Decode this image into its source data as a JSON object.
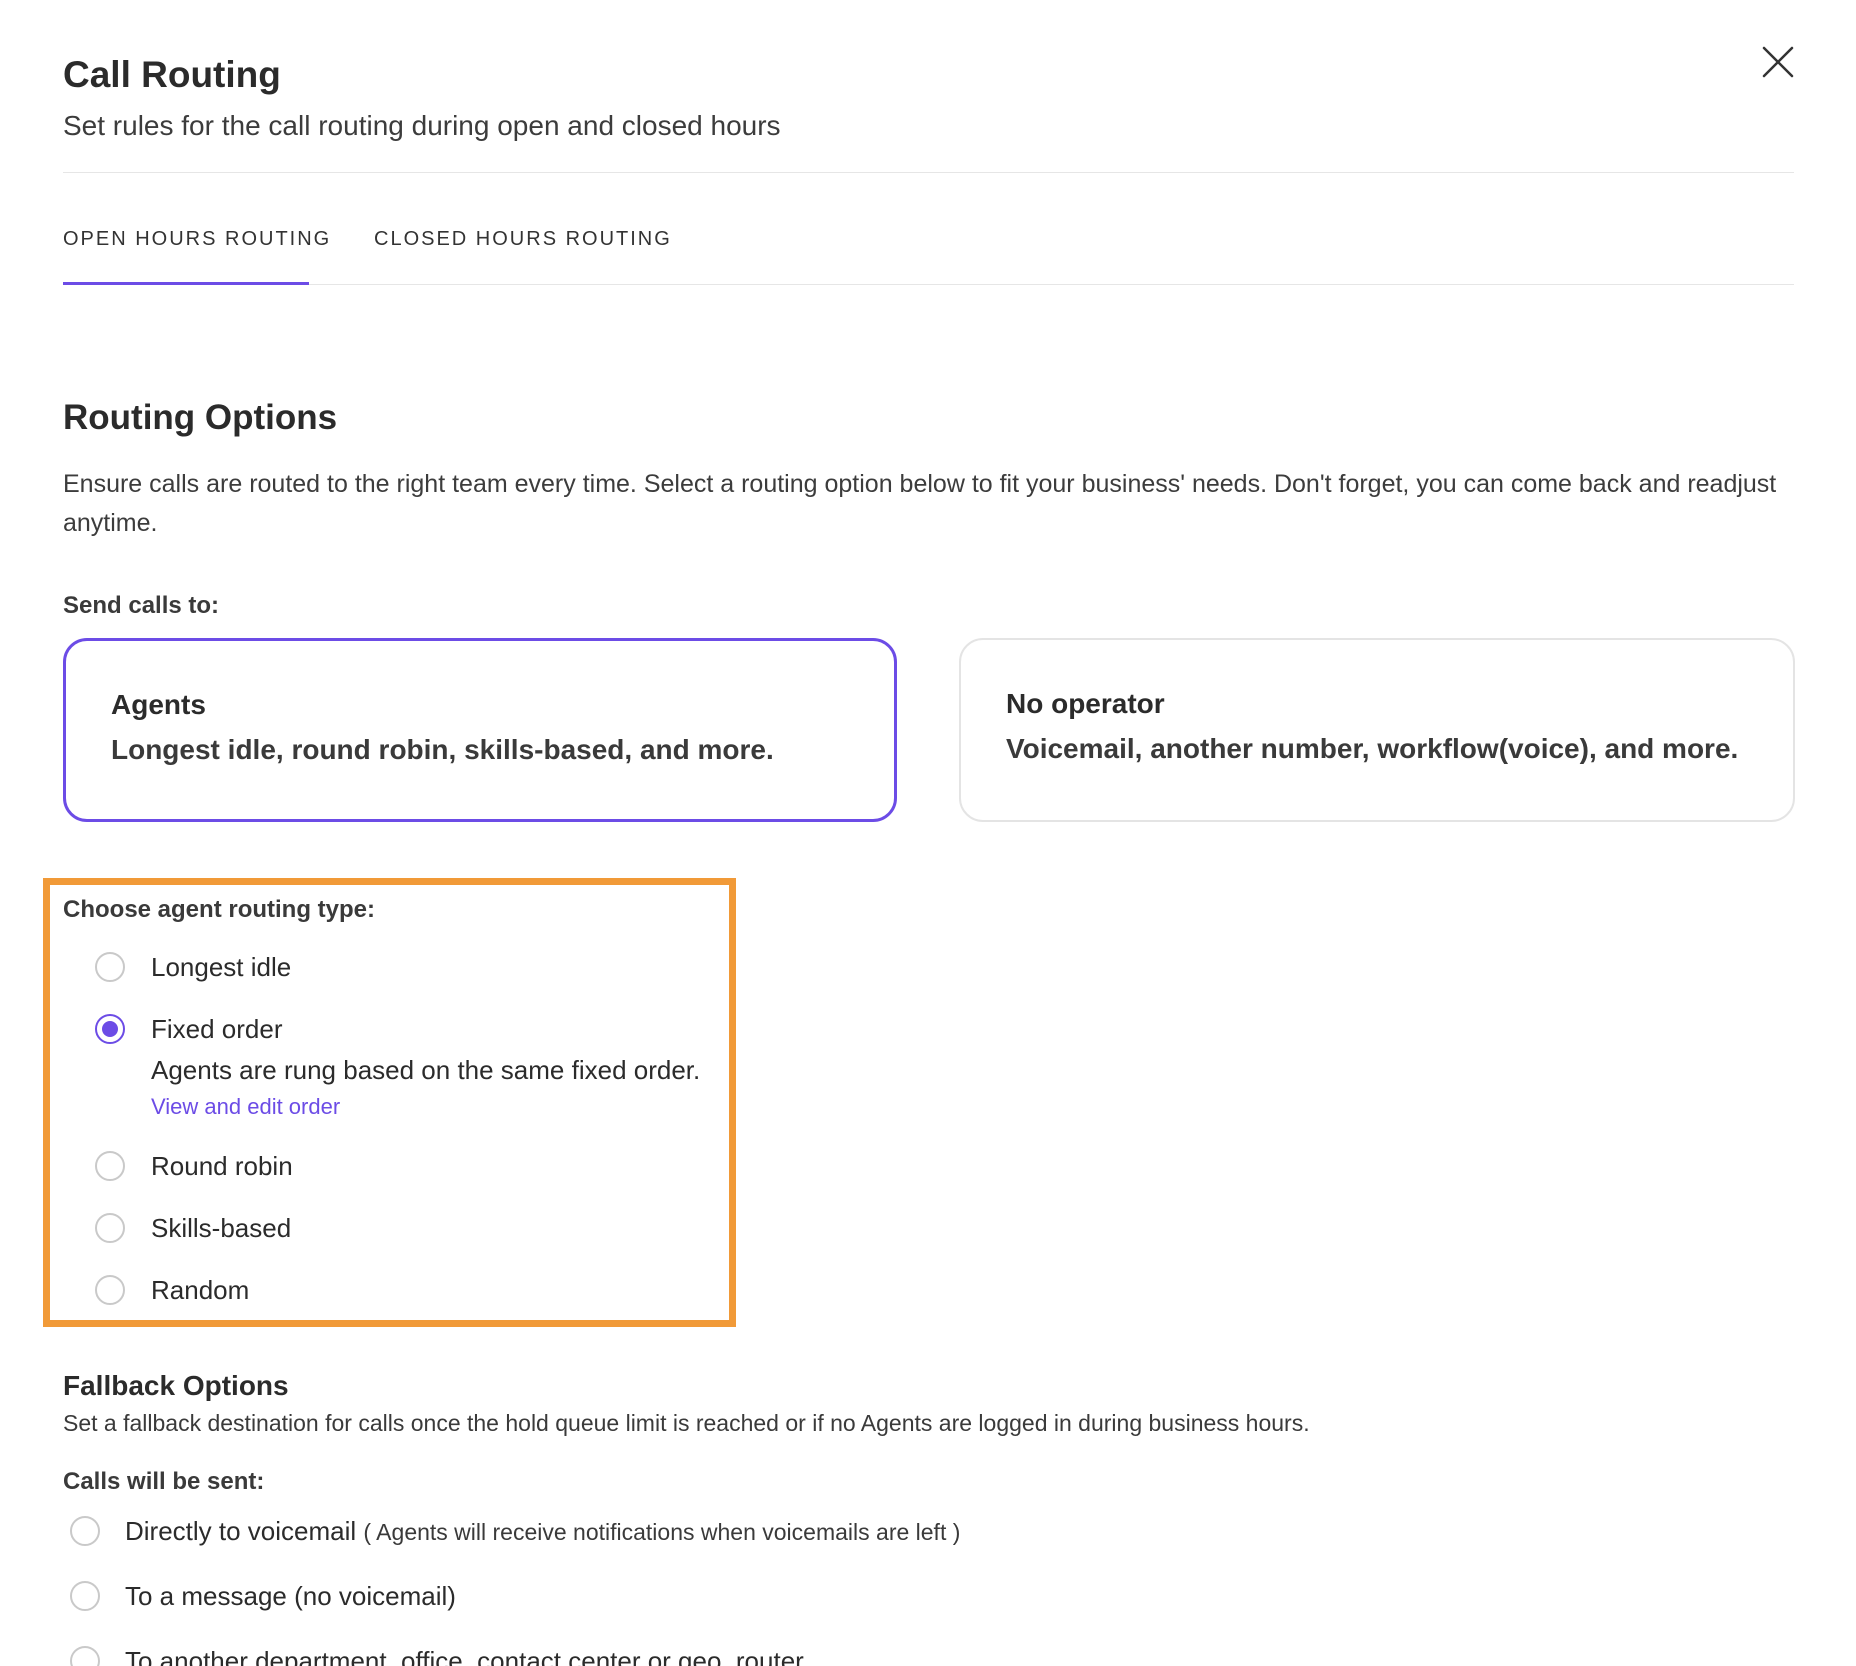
{
  "header": {
    "title": "Call Routing",
    "subtitle": "Set rules for the call routing during open and closed hours"
  },
  "tabs": [
    {
      "label": "OPEN HOURS ROUTING",
      "active": true
    },
    {
      "label": "CLOSED HOURS ROUTING",
      "active": false
    }
  ],
  "routing": {
    "title": "Routing Options",
    "description": "Ensure calls are routed to the right team every time. Select a routing option below to fit your business' needs. Don't forget, you can come back and readjust anytime.",
    "send_label": "Send calls to:",
    "cards": [
      {
        "title": "Agents",
        "desc": "Longest idle, round robin, skills-based, and more.",
        "selected": true
      },
      {
        "title": "No operator",
        "desc": "Voicemail, another number, workflow(voice), and more.",
        "selected": false
      }
    ]
  },
  "agent_routing": {
    "label": "Choose agent routing type:",
    "options": [
      {
        "label": "Longest idle",
        "checked": false
      },
      {
        "label": "Fixed order",
        "checked": true
      },
      {
        "label": "Round robin",
        "checked": false
      },
      {
        "label": "Skills-based",
        "checked": false
      },
      {
        "label": "Random",
        "checked": false
      }
    ],
    "fixed_order_desc": "Agents are rung based on the same fixed order.",
    "fixed_order_link": "View and edit order"
  },
  "fallback": {
    "title": "Fallback Options",
    "description": "Set a fallback destination for calls once the hold queue limit is reached or if no Agents are logged in during business hours.",
    "calls_label": "Calls will be sent:",
    "options": [
      {
        "label": "Directly to voicemail",
        "note": "( Agents will receive notifications when voicemails are left )"
      },
      {
        "label": "To a message (no voicemail)",
        "note": ""
      },
      {
        "label": "To another department, office, contact center or geo_router",
        "note": ""
      }
    ]
  },
  "colors": {
    "accent": "#6c4ce6",
    "highlight": "#f19a38",
    "border": "#e4e4e4"
  }
}
